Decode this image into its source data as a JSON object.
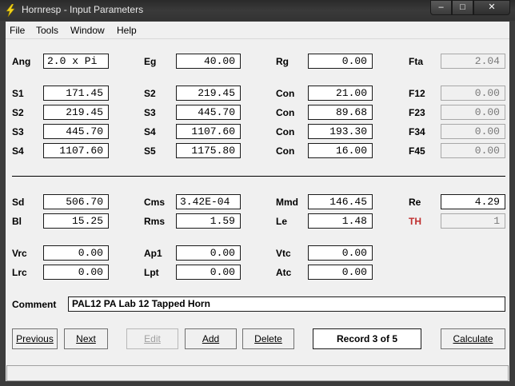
{
  "window": {
    "title": "Hornresp - Input Parameters"
  },
  "menu": [
    "File",
    "Tools",
    "Window",
    "Help"
  ],
  "params": {
    "ang": {
      "label": "Ang",
      "value": "2.0 x Pi"
    },
    "eg": {
      "label": "Eg",
      "value": "40.00"
    },
    "rg": {
      "label": "Rg",
      "value": "0.00"
    },
    "fta": {
      "label": "Fta",
      "value": "2.04"
    },
    "s1": {
      "label": "S1",
      "value": "171.45"
    },
    "s2a": {
      "label": "S2",
      "value": "219.45"
    },
    "s2b": {
      "label": "S2",
      "value": "219.45"
    },
    "s3a": {
      "label": "S3",
      "value": "445.70"
    },
    "s3b": {
      "label": "S3",
      "value": "445.70"
    },
    "s4a": {
      "label": "S4",
      "value": "1107.60"
    },
    "s4b": {
      "label": "S4",
      "value": "1107.60"
    },
    "s5": {
      "label": "S5",
      "value": "1175.80"
    },
    "con1": {
      "label": "Con",
      "value": "21.00"
    },
    "con2": {
      "label": "Con",
      "value": "89.68"
    },
    "con3": {
      "label": "Con",
      "value": "193.30"
    },
    "con4": {
      "label": "Con",
      "value": "16.00"
    },
    "f12": {
      "label": "F12",
      "value": "0.00"
    },
    "f23": {
      "label": "F23",
      "value": "0.00"
    },
    "f34": {
      "label": "F34",
      "value": "0.00"
    },
    "f45": {
      "label": "F45",
      "value": "0.00"
    },
    "sd": {
      "label": "Sd",
      "value": "506.70"
    },
    "cms": {
      "label": "Cms",
      "value": "3.42E-04"
    },
    "mmd": {
      "label": "Mmd",
      "value": "146.45"
    },
    "re": {
      "label": "Re",
      "value": "4.29"
    },
    "bl": {
      "label": "Bl",
      "value": "15.25"
    },
    "rms": {
      "label": "Rms",
      "value": "1.59"
    },
    "le": {
      "label": "Le",
      "value": "1.48"
    },
    "th": {
      "label": "TH",
      "value": "1"
    },
    "vrc": {
      "label": "Vrc",
      "value": "0.00"
    },
    "ap1": {
      "label": "Ap1",
      "value": "0.00"
    },
    "vtc": {
      "label": "Vtc",
      "value": "0.00"
    },
    "lrc": {
      "label": "Lrc",
      "value": "0.00"
    },
    "lpt": {
      "label": "Lpt",
      "value": "0.00"
    },
    "atc": {
      "label": "Atc",
      "value": "0.00"
    }
  },
  "comment": {
    "label": "Comment",
    "value": "PAL12 PA Lab 12 Tapped Horn"
  },
  "buttons": {
    "previous": "Previous",
    "next": "Next",
    "edit": "Edit",
    "add": "Add",
    "delete": "Delete",
    "calculate": "Calculate"
  },
  "record": "Record 3 of 5",
  "colors": {
    "th_label": "#c03030"
  }
}
